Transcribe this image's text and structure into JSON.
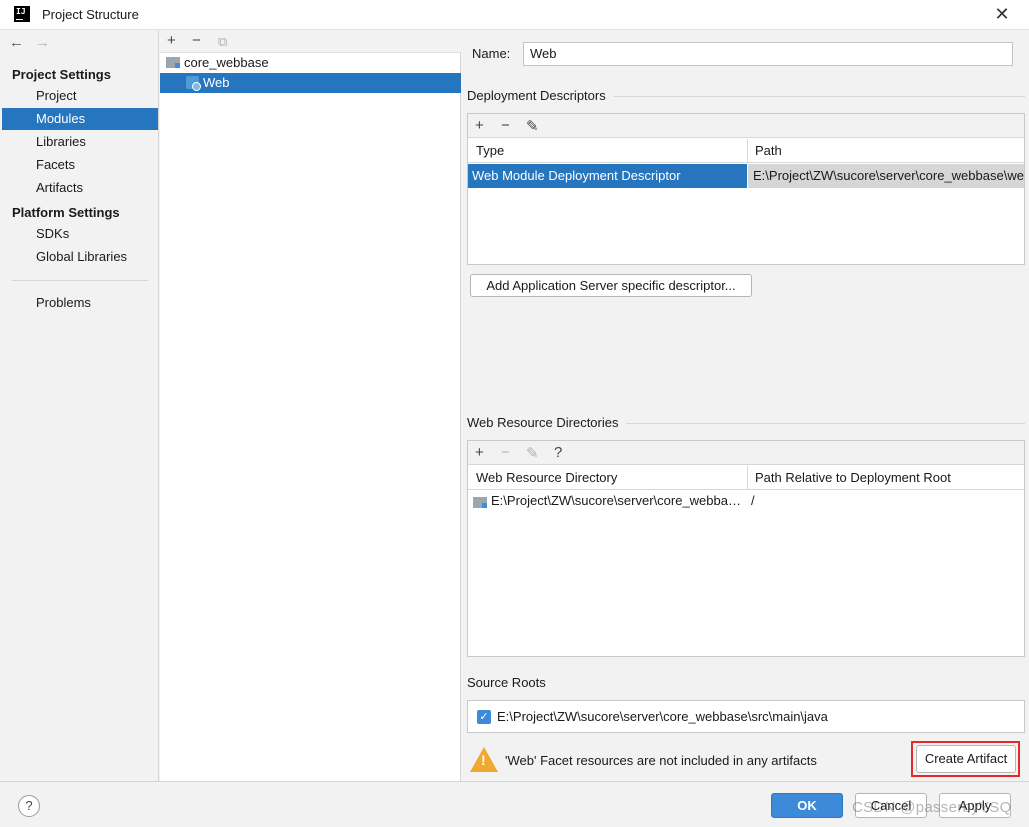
{
  "window": {
    "title": "Project Structure",
    "app_icon": "IJ",
    "close_glyph": "✕"
  },
  "nav": {
    "back": "←",
    "forward": "→",
    "project_settings_header": "Project Settings",
    "project_items": [
      "Project",
      "Modules",
      "Libraries",
      "Facets",
      "Artifacts"
    ],
    "selected": "Modules",
    "platform_settings_header": "Platform Settings",
    "platform_items": [
      "SDKs",
      "Global Libraries"
    ],
    "problems": "Problems"
  },
  "tree": {
    "toolbar": {
      "add": "+",
      "remove": "−",
      "copy": "⧉"
    },
    "root": "core_webbase",
    "child": "Web"
  },
  "facet": {
    "name_label": "Name:",
    "name_value": "Web",
    "deployment_descriptors_title": "Deployment Descriptors",
    "dd_toolbar": {
      "add": "+",
      "remove": "−",
      "edit": "✎"
    },
    "dd_columns": [
      "Type",
      "Path"
    ],
    "dd_rows": [
      {
        "type": "Web Module Deployment Descriptor",
        "path": "E:\\Project\\ZW\\sucore\\server\\core_webbase\\web\\WEB-INF\\web.xml"
      }
    ],
    "add_server_descriptor_button": "Add Application Server specific descriptor...",
    "web_resource_title": "Web Resource Directories",
    "wr_toolbar": {
      "add": "+",
      "remove": "−",
      "edit": "✎",
      "help": "?"
    },
    "wr_columns": [
      "Web Resource Directory",
      "Path Relative to Deployment Root"
    ],
    "wr_rows": [
      {
        "dir": "E:\\Project\\ZW\\sucore\\server\\core_webbase\\web",
        "relative": "/"
      }
    ],
    "source_roots_title": "Source Roots",
    "source_root": "E:\\Project\\ZW\\sucore\\server\\core_webbase\\src\\main\\java",
    "source_root_checked": true,
    "warning_text": "'Web' Facet resources are not included in any artifacts",
    "create_artifact_button": "Create Artifact"
  },
  "footer": {
    "help": "?",
    "ok": "OK",
    "cancel": "Cancel",
    "apply": "Apply"
  },
  "watermark": "CSDN @passerbyYSQ",
  "colors": {
    "selection": "#2675bf",
    "primary_button": "#3d8bd8",
    "highlight_box": "#e12a2a",
    "warning": "#f0a830"
  }
}
